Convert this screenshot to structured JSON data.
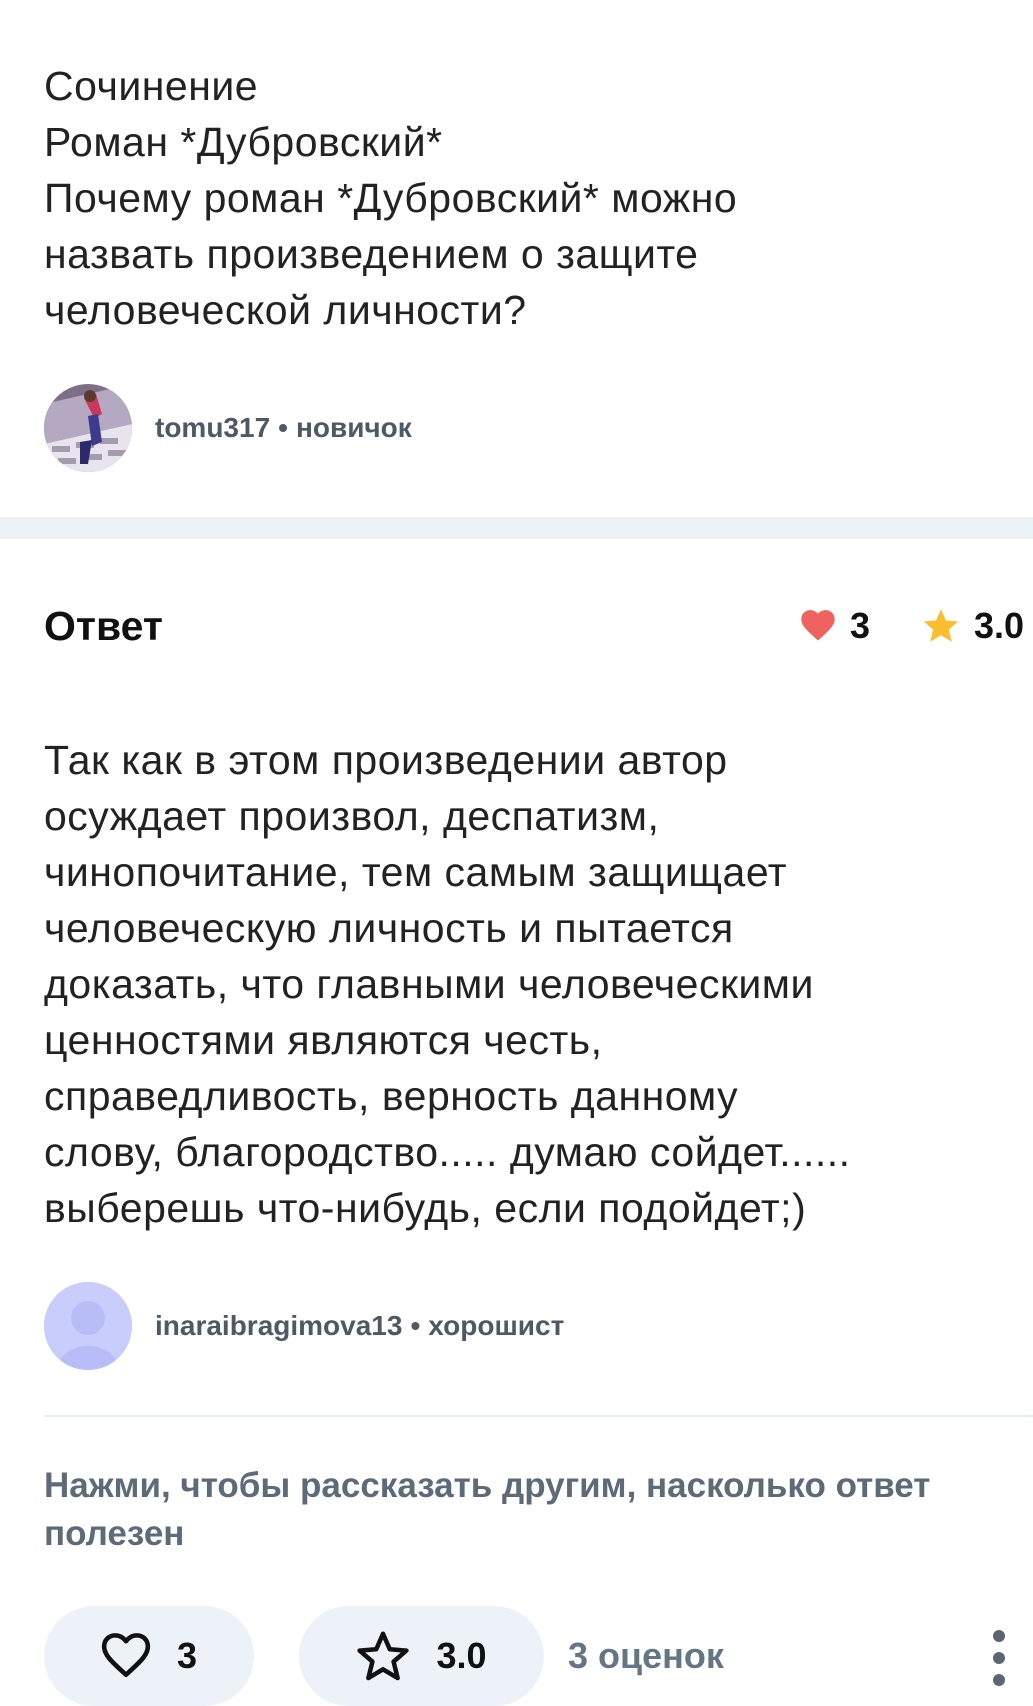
{
  "question": {
    "lines": [
      "Сочинение",
      "Роман *Дубровский*",
      "Почему роман *Дубровский* можно",
      "назвать произведением о защите",
      "человеческой личности?"
    ]
  },
  "asker": {
    "username": "tomu317",
    "separator": "•",
    "rank": "новичок"
  },
  "answer": {
    "title": "Ответ",
    "likes": "3",
    "rating": "3.0",
    "lines": [
      "Так как в этом произведении автор",
      "осуждает произвол, деспатизм,",
      "чинопочитание, тем самым защищает",
      "человеческую личность и пытается",
      "доказать, что главными человеческими",
      "ценностями являются честь,",
      "справедливость, верность данному",
      "слову, благородство..... думаю сойдет......",
      "выберешь что-нибудь, если подойдет;)"
    ],
    "author": {
      "username": "inaraibragimova13",
      "separator": "•",
      "rank": "хорошист"
    }
  },
  "rate_prompt": {
    "lines": [
      "Нажми, чтобы рассказать другим, насколько ответ",
      "полезен"
    ]
  },
  "actions": {
    "like_count": "3",
    "rating_value": "3.0",
    "ratings_count": "3 оценок"
  },
  "colors": {
    "heart": "#f0625d",
    "star": "#fbbe2e",
    "band": "#edf2f7",
    "pill": "#ecf2f8",
    "placeholder_avatar": "#c9cdfb",
    "muted_text": "#5d6a78"
  },
  "icons": {
    "like_stat": "heart-filled-icon",
    "rating_stat": "star-filled-icon",
    "like_button": "heart-outline-icon",
    "rate_button": "star-outline-icon",
    "more": "more-vertical-icon"
  }
}
